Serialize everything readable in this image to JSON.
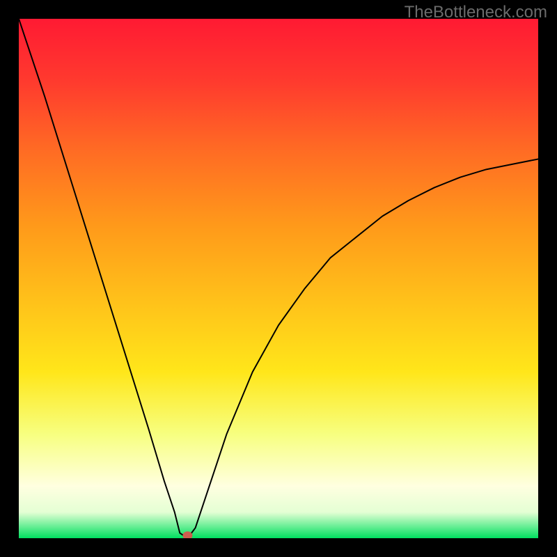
{
  "watermark": "TheBottleneck.com",
  "chart_data": {
    "type": "line",
    "title": "",
    "xlabel": "",
    "ylabel": "",
    "xlim": [
      0,
      100
    ],
    "ylim": [
      0,
      100
    ],
    "grid": false,
    "legend": false,
    "background_gradient": {
      "top": "#ff1a33",
      "mid": "#ffc31a",
      "bottom": "#00e060"
    },
    "series": [
      {
        "name": "bottleneck-curve",
        "color": "#000000",
        "x": [
          0,
          5,
          10,
          15,
          20,
          25,
          28,
          30,
          31,
          32.5,
          34,
          36,
          40,
          45,
          50,
          55,
          60,
          65,
          70,
          75,
          80,
          85,
          90,
          95,
          100
        ],
        "y": [
          100,
          85,
          69,
          53,
          37,
          21,
          11,
          5,
          1,
          0,
          2,
          8,
          20,
          32,
          41,
          48,
          54,
          58,
          62,
          65,
          67.5,
          69.5,
          71,
          72,
          73
        ]
      }
    ],
    "marker": {
      "name": "optimal-point",
      "x": 32.5,
      "y": 0.5,
      "color": "#cc5e4f",
      "shape": "ellipse"
    }
  }
}
